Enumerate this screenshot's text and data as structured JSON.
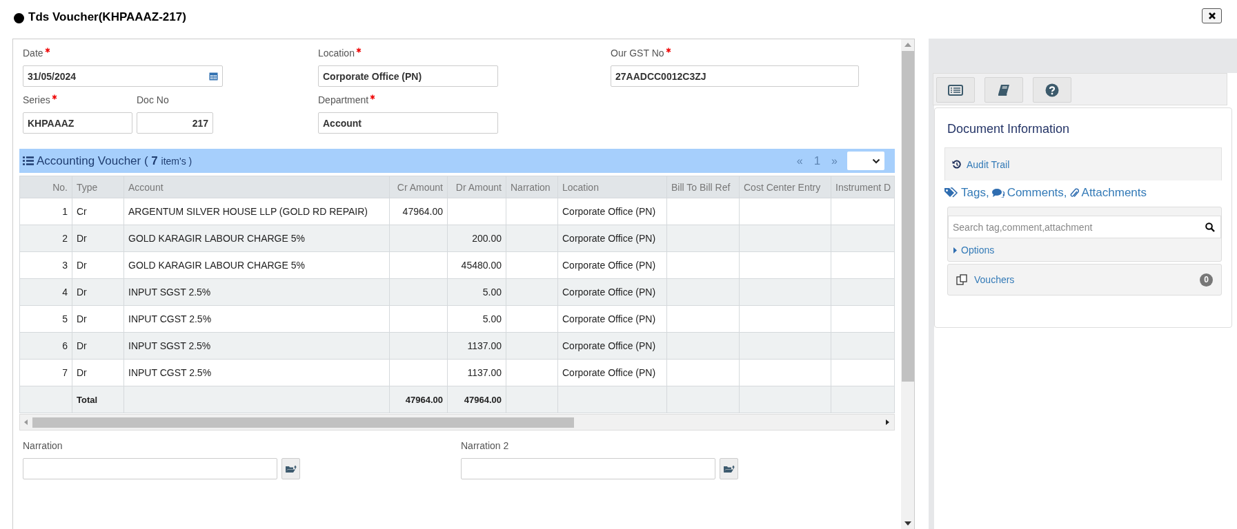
{
  "window": {
    "title": "Tds Voucher(KHPAAAZ-217)"
  },
  "form": {
    "date": {
      "label": "Date",
      "required": true,
      "value": "31/05/2024"
    },
    "location": {
      "label": "Location",
      "required": true,
      "value": "Corporate Office (PN)"
    },
    "gst": {
      "label": "Our GST No",
      "required": true,
      "value": "27AADCC0012C3ZJ"
    },
    "series": {
      "label": "Series",
      "required": true,
      "value": "KHPAAAZ"
    },
    "doc_no": {
      "label": "Doc No",
      "required": false,
      "value": "217"
    },
    "department": {
      "label": "Department",
      "required": true,
      "value": "Account"
    }
  },
  "voucher_table": {
    "title": "Accounting Voucher (",
    "count": "7",
    "count_suffix": "item's )",
    "pager": {
      "prev": "«",
      "page": "1",
      "next": "»"
    },
    "columns": [
      "No.",
      "Type",
      "Account",
      "Cr Amount",
      "Dr Amount",
      "Narration",
      "Location",
      "Bill To Bill Ref",
      "Cost Center Entry",
      "Instrument D"
    ],
    "rows": [
      {
        "cells": [
          "1",
          "Cr",
          "ARGENTUM SILVER HOUSE LLP (GOLD RD REPAIR)",
          "47964.00",
          "",
          "",
          "Corporate Office (PN)",
          "",
          "",
          ""
        ]
      },
      {
        "cells": [
          "2",
          "Dr",
          "GOLD KARAGIR LABOUR CHARGE 5%",
          "",
          "200.00",
          "",
          "Corporate Office (PN)",
          "",
          "",
          ""
        ]
      },
      {
        "cells": [
          "3",
          "Dr",
          "GOLD KARAGIR LABOUR CHARGE 5%",
          "",
          "45480.00",
          "",
          "Corporate Office (PN)",
          "",
          "",
          ""
        ]
      },
      {
        "cells": [
          "4",
          "Dr",
          "INPUT SGST 2.5%",
          "",
          "5.00",
          "",
          "Corporate Office (PN)",
          "",
          "",
          ""
        ]
      },
      {
        "cells": [
          "5",
          "Dr",
          "INPUT CGST 2.5%",
          "",
          "5.00",
          "",
          "Corporate Office (PN)",
          "",
          "",
          ""
        ]
      },
      {
        "cells": [
          "6",
          "Dr",
          "INPUT SGST 2.5%",
          "",
          "1137.00",
          "",
          "Corporate Office (PN)",
          "",
          "",
          ""
        ]
      },
      {
        "cells": [
          "7",
          "Dr",
          "INPUT CGST 2.5%",
          "",
          "1137.00",
          "",
          "Corporate Office (PN)",
          "",
          "",
          ""
        ]
      }
    ],
    "total": {
      "cells": [
        "",
        "Total",
        "",
        "47964.00",
        "47964.00",
        "",
        "",
        "",
        "",
        ""
      ]
    }
  },
  "narrations": [
    {
      "label": "Narration"
    },
    {
      "label": "Narration 2"
    }
  ],
  "side_panel": {
    "title": "Document Information",
    "audit_trail": "Audit Trail",
    "tags": "Tags,",
    "comments": "Comments,",
    "attachments": "Attachments",
    "search": {
      "placeholder": "Search tag,comment,attachment"
    },
    "options": "Options",
    "vouchers": {
      "label": "Vouchers",
      "count": "0"
    }
  }
}
